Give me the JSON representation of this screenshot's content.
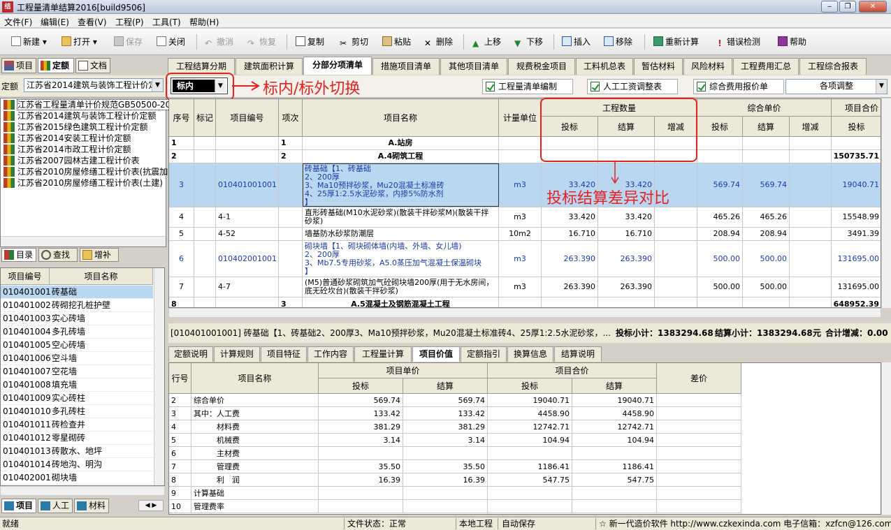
{
  "window": {
    "title": "工程量清单结算2016[build9506]",
    "app_icon_text": "结"
  },
  "menu": [
    "文件(F)",
    "编辑(E)",
    "查看(V)",
    "工程(P)",
    "工具(T)",
    "帮助(H)"
  ],
  "toolbar": {
    "new": "新建",
    "open": "打开",
    "save": "保存",
    "close": "关闭",
    "undo": "撤消",
    "redo": "恢复",
    "copy": "复制",
    "cut": "剪切",
    "paste": "粘贴",
    "delete": "删除",
    "up": "上移",
    "down": "下移",
    "insert": "插入",
    "remove": "移除",
    "recalc": "重新计算",
    "check": "错误检测",
    "help": "帮助"
  },
  "left_tabs": [
    "项目",
    "定额",
    "文档"
  ],
  "quota": {
    "label": "定额",
    "value": "江苏省2014建筑与装饰工程计价定额"
  },
  "quota_tree": [
    "江苏省工程量清单计价规范GB50500-2013",
    "江苏省2014建筑与装饰工程计价定额",
    "江苏省2015绿色建筑工程计价定额",
    "江苏省2014安装工程计价定额",
    "江苏省2014市政工程计价定额",
    "江苏省2007园林古建工程计价表",
    "江苏省2010房屋修缮工程计价表(抗震加固)",
    "江苏省2010房屋修缮工程计价表(土建)"
  ],
  "left_mid_tabs": [
    "目录",
    "查找",
    "增补"
  ],
  "item_table": {
    "headers": [
      "项目编号",
      "项目名称"
    ],
    "rows": [
      [
        "010401001",
        "砖基础"
      ],
      [
        "010401002",
        "砖砌挖孔桩护壁"
      ],
      [
        "010401003",
        "实心砖墙"
      ],
      [
        "010401004",
        "多孔砖墙"
      ],
      [
        "010401005",
        "空心砖墙"
      ],
      [
        "010401006",
        "空斗墙"
      ],
      [
        "010401007",
        "空花墙"
      ],
      [
        "010401008",
        "填充墙"
      ],
      [
        "010401009",
        "实心砖柱"
      ],
      [
        "010401010",
        "多孔砖柱"
      ],
      [
        "010401011",
        "砖检查井"
      ],
      [
        "010401012",
        "零星砌砖"
      ],
      [
        "010401013",
        "砖散水、地坪"
      ],
      [
        "010401014",
        "砖地沟、明沟"
      ],
      [
        "010402001",
        "砌块墙"
      ]
    ]
  },
  "left_bottom_tabs": [
    "项目",
    "人工",
    "材料"
  ],
  "main_tabs": [
    "工程结算分期",
    "建筑面积计算",
    "分部分项清单",
    "措施项目清单",
    "其他项目清单",
    "规费税金项目",
    "工料机总表",
    "暂估材料",
    "风险材料",
    "工程费用汇总",
    "工程综合报表"
  ],
  "subbar": {
    "scope_value": "标内",
    "annot_switch": "标内/标外切换",
    "btn1": "工程量清单编制",
    "btn2": "人工工资调整表",
    "btn3": "综合费用报价单",
    "adjust": "各项调整"
  },
  "grid": {
    "headers": {
      "seq": "序号",
      "mark": "标记",
      "code": "项目编号",
      "level": "项次",
      "name": "项目名称",
      "unit": "计量单位",
      "qty": "工程数量",
      "price": "综合单价",
      "total": "项目合价",
      "bid": "投标",
      "settle": "结算",
      "diff": "增减"
    },
    "annot_compare": "投标结算差异对比",
    "rows": [
      {
        "seq": "1",
        "code": "",
        "level": "1",
        "name": "A.站房",
        "unit": "",
        "q1": "",
        "q2": "",
        "q3": "",
        "p1": "",
        "p2": "",
        "p3": "",
        "t1": ""
      },
      {
        "seq": "2",
        "code": "",
        "level": "2",
        "name": "A.4砌筑工程",
        "unit": "",
        "q1": "",
        "q2": "",
        "q3": "",
        "p1": "",
        "p2": "",
        "p3": "",
        "t1": "150735.71"
      },
      {
        "seq": "3",
        "code": "010401001001",
        "level": "",
        "name": "砖基础【1、砖基础\n2、200厚\n3、Ma10预拌砂浆，Mu20混凝土标准砖\n4、25厚1:2.5水泥砂浆，内掺5%防水剂\n】",
        "unit": "m3",
        "q1": "33.420",
        "q2": "33.420",
        "q3": "",
        "p1": "569.74",
        "p2": "569.74",
        "p3": "",
        "t1": "19040.71"
      },
      {
        "seq": "4",
        "code": "4-1",
        "level": "",
        "name": "直形砖基础(M10水泥砂浆)(散装干拌砂浆M)(散装干拌砂浆)",
        "unit": "m3",
        "q1": "33.420",
        "q2": "33.420",
        "q3": "",
        "p1": "465.26",
        "p2": "465.26",
        "p3": "",
        "t1": "15548.99"
      },
      {
        "seq": "5",
        "code": "4-52",
        "level": "",
        "name": "墙基防水砂浆防潮层",
        "unit": "10m2",
        "q1": "16.710",
        "q2": "16.710",
        "q3": "",
        "p1": "208.94",
        "p2": "208.94",
        "p3": "",
        "t1": "3491.39"
      },
      {
        "seq": "6",
        "code": "010402001001",
        "level": "",
        "name": "砌块墙【1、砌块砌体墙(内墙、外墙、女儿墙)\n2、200厚\n3、Mb7.5专用砂浆，A5.0蒸压加气混凝土保温砌块\n】",
        "unit": "m3",
        "q1": "263.390",
        "q2": "263.390",
        "q3": "",
        "p1": "500.00",
        "p2": "500.00",
        "p3": "",
        "t1": "131695.00"
      },
      {
        "seq": "7",
        "code": "4-7",
        "level": "",
        "name": "(M5)普通砂浆砌筑加气砼砌块墙200厚(用于无水房间，底无砼坎台)(散装干拌砂浆)",
        "unit": "m3",
        "q1": "263.390",
        "q2": "263.390",
        "q3": "",
        "p1": "500.00",
        "p2": "500.00",
        "p3": "",
        "t1": "131695.00"
      },
      {
        "seq": "8",
        "code": "",
        "level": "3",
        "name": "A.5混凝土及钢筋混凝土工程",
        "unit": "",
        "q1": "",
        "q2": "",
        "q3": "",
        "p1": "",
        "p2": "",
        "p3": "",
        "t1": "648952.39"
      }
    ]
  },
  "infobar": {
    "desc": "[010401001001] 砖基础【1、砖基础2、200厚3、Ma10预拌砂浆，Mu20混凝土标准砖4、25厚1:2.5水泥砂浆，...",
    "bid_sub": "投标小计：1383294.68",
    "settle_sub": "结算小计：1383294.68",
    "unit": "元",
    "diff_sum": "合计增减：0.00"
  },
  "bottom_tabs": [
    "定额说明",
    "计算规则",
    "项目特征",
    "工作内容",
    "工程量计算",
    "项目价值",
    "定额指引",
    "换算信息",
    "结算说明"
  ],
  "bottom_grid": {
    "headers": {
      "row": "行号",
      "name": "项目名称",
      "unit_price": "项目单价",
      "total_price": "项目合价",
      "bid": "投标",
      "settle": "结算",
      "diff": "差价"
    },
    "rows": [
      {
        "n": "2",
        "name": "综合单价",
        "a": "569.74",
        "b": "569.74",
        "c": "19040.71",
        "d": "19040.71"
      },
      {
        "n": "3",
        "name": "其中：人工费",
        "a": "133.42",
        "b": "133.42",
        "c": "4458.90",
        "d": "4458.90"
      },
      {
        "n": "4",
        "name": "　　　材料费",
        "a": "381.29",
        "b": "381.29",
        "c": "12742.71",
        "d": "12742.71"
      },
      {
        "n": "5",
        "name": "　　　机械费",
        "a": "3.14",
        "b": "3.14",
        "c": "104.94",
        "d": "104.94"
      },
      {
        "n": "6",
        "name": "　　　主材费",
        "a": "",
        "b": "",
        "c": "",
        "d": ""
      },
      {
        "n": "7",
        "name": "　　　管理费",
        "a": "35.50",
        "b": "35.50",
        "c": "1186.41",
        "d": "1186.41"
      },
      {
        "n": "8",
        "name": "　　　利　润",
        "a": "16.39",
        "b": "16.39",
        "c": "547.75",
        "d": "547.75"
      },
      {
        "n": "9",
        "name": "计算基础",
        "a": "",
        "b": "",
        "c": "",
        "d": ""
      },
      {
        "n": "10",
        "name": "管理费率",
        "a": "",
        "b": "",
        "c": "",
        "d": ""
      }
    ]
  },
  "status": {
    "ready": "就绪",
    "file_state": "文件状态：正常",
    "local": "本地工程",
    "autosave": "自动保存",
    "promo": "☆ 新一代造价软件 http://www.czkexinda.com 电子信箱：xzfcn@126.com"
  },
  "colors": {
    "annotation": "#e52121",
    "selected_row": "#b9d7f0",
    "blue_text": "#1a3aa8"
  }
}
